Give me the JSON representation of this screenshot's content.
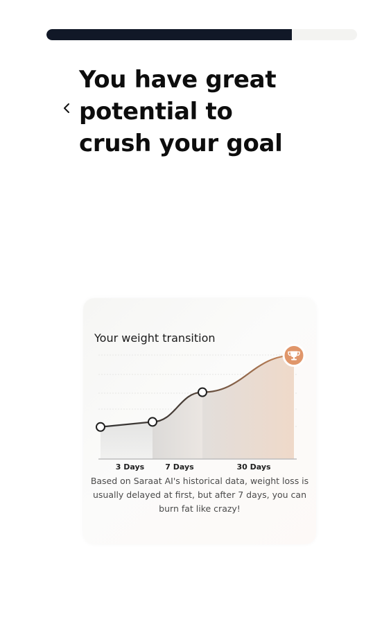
{
  "progress": {
    "value_percent": 79
  },
  "header": {
    "back_icon": "chevron-left-icon",
    "title": "You have great potential to crush your goal"
  },
  "card": {
    "title": "Your weight transition",
    "description": "Based on Saraat AI's historical data, weight loss is usually delayed at first, but after 7 days, you can burn fat like crazy!",
    "goal_icon": "trophy-icon"
  },
  "chart_data": {
    "type": "area",
    "title": "Your weight transition",
    "categories": [
      "3 Days",
      "7 Days",
      "30 Days"
    ],
    "series": [
      {
        "points": [
          0.3,
          0.35,
          0.64,
          1.0
        ]
      }
    ],
    "colors": {
      "line_start": "#333333",
      "line_end": "#d08b5b",
      "marker_fill": "#ffffff",
      "goal_badge": "#e0966a"
    },
    "grid": true
  }
}
